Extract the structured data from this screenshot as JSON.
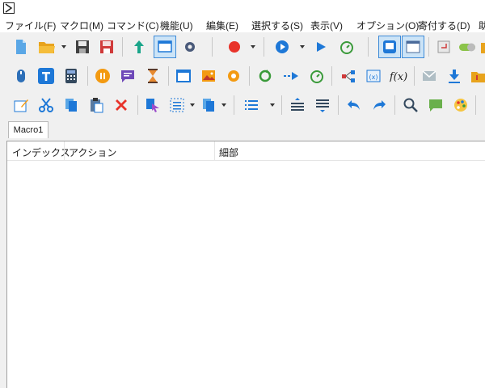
{
  "menu": [
    "ファイル(F)",
    "マクロ(M)",
    "コマンド(C)",
    "機能(U)",
    "編集(E)",
    "選択する(S)",
    "表示(V)",
    "オプション(O)",
    "寄付する(D)",
    "助"
  ],
  "tab": {
    "label": "Macro1"
  },
  "table": {
    "columns": [
      "インデックス",
      "アクション",
      "細部"
    ]
  },
  "icons": {
    "row1": [
      "new-file-icon",
      "open-folder-icon",
      "save-icon",
      "save-as-icon",
      "upload-icon",
      "view-panel-icon",
      "settings-gear-icon",
      "record-icon",
      "play-icon",
      "play-simple-icon",
      "timer-icon",
      "window-capture-icon",
      "window-mode-icon",
      "enter-key-icon",
      "toggle-icon",
      "folder-alert-icon"
    ],
    "row2": [
      "mouse-icon",
      "text-icon",
      "calculator-icon",
      "pause-icon",
      "comment-icon",
      "hourglass-icon",
      "window-icon",
      "image-icon",
      "gear-orange-icon",
      "repeat-icon",
      "goto-arrow-icon",
      "timer-icon",
      "share-icon",
      "variable-icon",
      "function-icon",
      "mail-icon",
      "download-icon",
      "folder-icon"
    ],
    "row3": [
      "edit-icon",
      "cut-icon",
      "copy-icon",
      "paste-icon",
      "delete-icon",
      "select-icon",
      "select-all-icon",
      "duplicate-icon",
      "list-icon",
      "move-up-icon",
      "move-down-icon",
      "undo-icon",
      "redo-icon",
      "search-icon",
      "speech-icon",
      "palette-icon"
    ]
  },
  "colors": {
    "accent_blue": "#1e78d7",
    "record_red": "#e8332a",
    "green": "#3a9a3a",
    "orange": "#f39a11",
    "purple": "#6e48b8"
  }
}
